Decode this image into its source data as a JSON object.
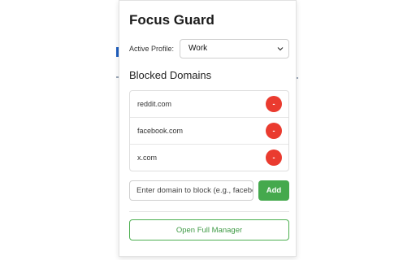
{
  "popup": {
    "title": "Focus Guard",
    "profile_label": "Active Profile:",
    "profile_selected": "Work",
    "blocked_title": "Blocked Domains",
    "domains": [
      {
        "name": "reddit.com",
        "remove_label": "-"
      },
      {
        "name": "facebook.com",
        "remove_label": "-"
      },
      {
        "name": "x.com",
        "remove_label": "-"
      }
    ],
    "input_placeholder": "Enter domain to block (e.g., facebook.com)",
    "add_label": "Add",
    "manager_label": "Open Full Manager"
  },
  "colors": {
    "remove": "#ea3b2f",
    "add": "#45a94d",
    "manager_border": "#4caf50"
  }
}
